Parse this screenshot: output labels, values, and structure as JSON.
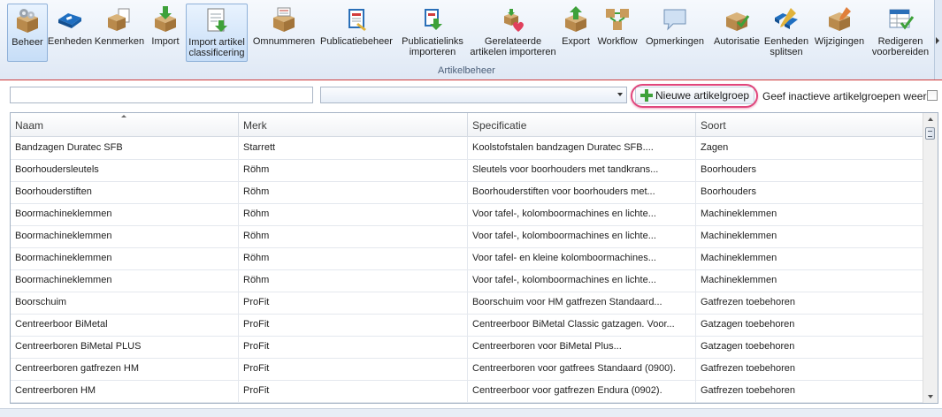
{
  "ribbon": {
    "group_label": "Artikelbeheer",
    "buttons": [
      {
        "id": "beheer",
        "label": "Beheer",
        "icon": "gears-box-icon",
        "active": true
      },
      {
        "id": "eenheden",
        "label": "Eenheden",
        "icon": "blue-tags-icon",
        "active": false
      },
      {
        "id": "kenmerken",
        "label": "Kenmerken",
        "icon": "box-documents-icon",
        "active": false
      },
      {
        "id": "import",
        "label": "Import",
        "icon": "box-import-arrow-icon",
        "active": false
      },
      {
        "id": "import_artikel",
        "label": "Import artikel\nclassificering",
        "icon": "document-import-icon",
        "active": true
      },
      {
        "id": "omnummeren",
        "label": "Omnummeren",
        "icon": "box-list-icon",
        "active": false
      },
      {
        "id": "publicatiebeheer",
        "label": "Publicatiebeheer",
        "icon": "publication-book-icon",
        "active": false
      },
      {
        "id": "publicatielinks",
        "label": "Publicatielinks\nimporteren",
        "icon": "publication-link-import-icon",
        "active": false
      },
      {
        "id": "gerelateerde",
        "label": "Gerelateerde\nartikelen importeren",
        "icon": "related-boxes-heart-icon",
        "active": false
      },
      {
        "id": "export",
        "label": "Export",
        "icon": "box-export-arrow-icon",
        "active": false
      },
      {
        "id": "workflow",
        "label": "Workflow",
        "icon": "workflow-boxes-icon",
        "active": false
      },
      {
        "id": "opmerkingen",
        "label": "Opmerkingen",
        "icon": "speech-bubble-icon",
        "active": false
      },
      {
        "id": "autorisatie",
        "label": "Autorisatie",
        "icon": "box-checkmark-icon",
        "active": false
      },
      {
        "id": "eenheden_splitsen",
        "label": "Eenheden\nsplitsen",
        "icon": "split-tags-icon",
        "active": false
      },
      {
        "id": "wijzigingen",
        "label": "Wijzigingen",
        "icon": "box-pencil-icon",
        "active": false
      },
      {
        "id": "redigeren",
        "label": "Redigeren\nvoorbereiden",
        "icon": "table-checkmark-icon",
        "active": false
      }
    ]
  },
  "filters": {
    "search_value": "",
    "combo_value": "",
    "new_group_label": "Nieuwe artikelgroep",
    "inactive_label": "Geef inactieve artikelgroepen weer",
    "inactive_checked": false
  },
  "grid": {
    "columns": [
      "Naam",
      "Merk",
      "Specificatie",
      "Soort"
    ],
    "sorted_column": "Naam",
    "rows": [
      [
        "Bandzagen Duratec SFB",
        "Starrett",
        "Koolstofstalen bandzagen Duratec SFB....",
        "Zagen"
      ],
      [
        "Boorhoudersleutels",
        "Röhm",
        "Sleutels voor boorhouders met tandkrans...",
        "Boorhouders"
      ],
      [
        "Boorhouderstiften",
        "Röhm",
        "Boorhouderstiften voor boorhouders met...",
        "Boorhouders"
      ],
      [
        "Boormachineklemmen",
        "Röhm",
        "Voor tafel-, kolomboormachines en lichte...",
        "Machineklemmen"
      ],
      [
        "Boormachineklemmen",
        "Röhm",
        "Voor tafel-, kolomboormachines en lichte...",
        "Machineklemmen"
      ],
      [
        "Boormachineklemmen",
        "Röhm",
        "Voor tafel- en kleine kolomboormachines...",
        "Machineklemmen"
      ],
      [
        "Boormachineklemmen",
        "Röhm",
        "Voor tafel-, kolomboormachines en lichte...",
        "Machineklemmen"
      ],
      [
        "Boorschuim",
        "ProFit",
        "Boorschuim voor HM gatfrezen Standaard...",
        "Gatfrezen toebehoren"
      ],
      [
        "Centreerboor BiMetal",
        "ProFit",
        "Centreerboor BiMetal Classic gatzagen. Voor...",
        "Gatzagen toebehoren"
      ],
      [
        "Centreerboren BiMetal PLUS",
        "ProFit",
        "Centreerboren voor BiMetal Plus...",
        "Gatzagen toebehoren"
      ],
      [
        "Centreerboren gatfrezen HM",
        "ProFit",
        "Centreerboren voor gatfrees Standaard (0900).",
        "Gatfrezen toebehoren"
      ],
      [
        "Centreerboren HM",
        "ProFit",
        "Centreerboor voor gatfrezen Endura (0902).",
        "Gatfrezen toebehoren"
      ]
    ]
  },
  "colors": {
    "ribbon_bg": "#e9f0f9",
    "accent_border": "#8fb1d9",
    "highlight": "#e0467c",
    "separator_red": "#cf3b3b"
  }
}
